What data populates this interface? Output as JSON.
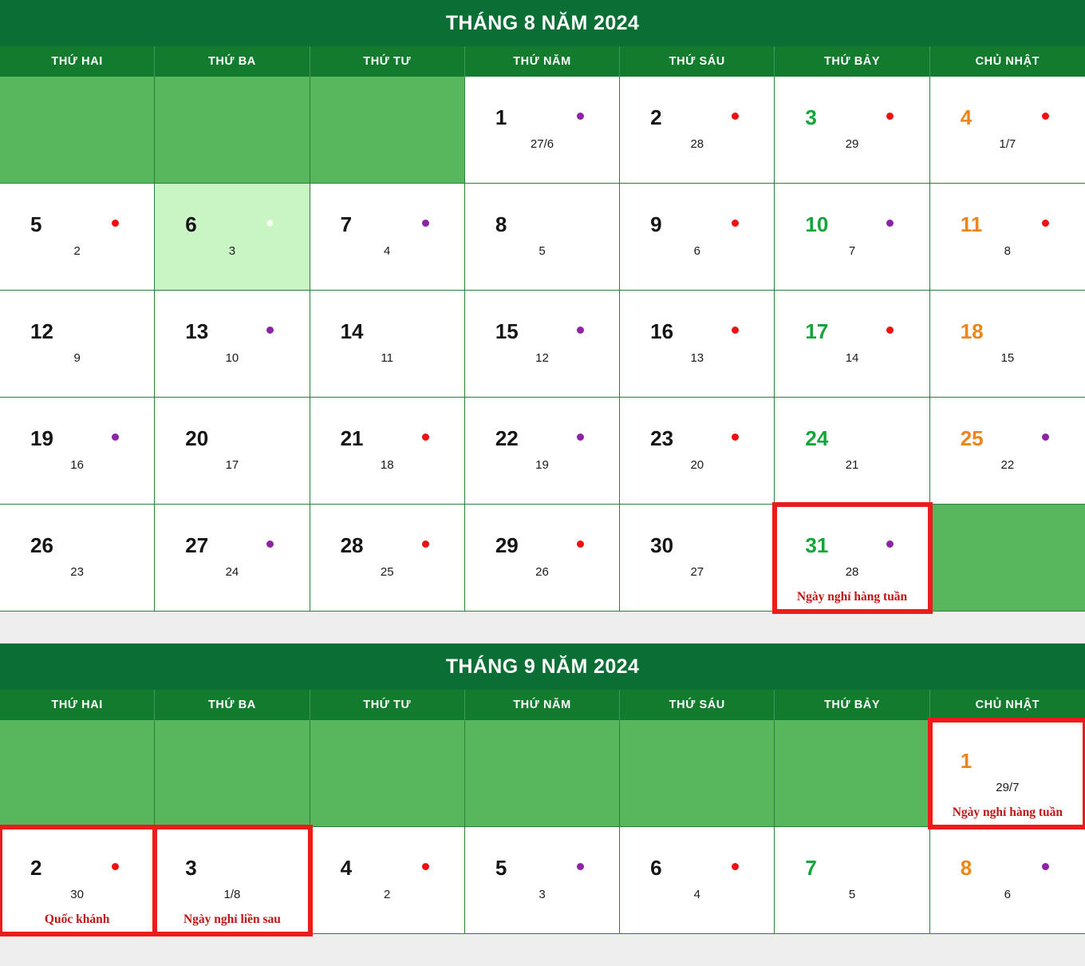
{
  "colors": {
    "header_dark_green": "#0b6e34",
    "header_green": "#137b2d",
    "blank_green": "#58b75c",
    "today_green": "#c9f5c4",
    "saturday": "#13a538",
    "sunday": "#ef8419",
    "note_red": "#c01515",
    "marker_red": "#ee1b1b",
    "dot_red": "#ee1111",
    "dot_purple": "#8d24a6"
  },
  "weekdays": [
    "THỨ HAI",
    "THỨ BA",
    "THỨ TƯ",
    "THỨ NĂM",
    "THỨ SÁU",
    "THỨ BẢY",
    "CHỦ NHẬT"
  ],
  "months": [
    {
      "title": "THÁNG 8 NĂM 2024",
      "weekdays": [
        "THỨ HAI",
        "THỨ BA",
        "THỨ TƯ",
        "THỨ NĂM",
        "THỨ SÁU",
        "THỨ BẢY",
        "CHỦ NHẬT"
      ],
      "cells": [
        {
          "blank": true
        },
        {
          "blank": true
        },
        {
          "blank": true
        },
        {
          "day": "1",
          "lunar": "27/6",
          "dot": "purple"
        },
        {
          "day": "2",
          "lunar": "28",
          "dot": "red"
        },
        {
          "day": "3",
          "lunar": "29",
          "dot": "red",
          "kind": "sat"
        },
        {
          "day": "4",
          "lunar": "1/7",
          "dot": "red",
          "kind": "sun"
        },
        {
          "day": "5",
          "lunar": "2",
          "dot": "red"
        },
        {
          "day": "6",
          "lunar": "3",
          "dot": "pale",
          "today": true
        },
        {
          "day": "7",
          "lunar": "4",
          "dot": "purple"
        },
        {
          "day": "8",
          "lunar": "5"
        },
        {
          "day": "9",
          "lunar": "6",
          "dot": "red"
        },
        {
          "day": "10",
          "lunar": "7",
          "dot": "purple",
          "kind": "sat"
        },
        {
          "day": "11",
          "lunar": "8",
          "dot": "red",
          "kind": "sun"
        },
        {
          "day": "12",
          "lunar": "9"
        },
        {
          "day": "13",
          "lunar": "10",
          "dot": "purple"
        },
        {
          "day": "14",
          "lunar": "11"
        },
        {
          "day": "15",
          "lunar": "12",
          "dot": "purple"
        },
        {
          "day": "16",
          "lunar": "13",
          "dot": "red"
        },
        {
          "day": "17",
          "lunar": "14",
          "dot": "red",
          "kind": "sat"
        },
        {
          "day": "18",
          "lunar": "15",
          "kind": "sun"
        },
        {
          "day": "19",
          "lunar": "16",
          "dot": "purple"
        },
        {
          "day": "20",
          "lunar": "17"
        },
        {
          "day": "21",
          "lunar": "18",
          "dot": "red"
        },
        {
          "day": "22",
          "lunar": "19",
          "dot": "purple"
        },
        {
          "day": "23",
          "lunar": "20",
          "dot": "red"
        },
        {
          "day": "24",
          "lunar": "21",
          "kind": "sat"
        },
        {
          "day": "25",
          "lunar": "22",
          "dot": "purple",
          "kind": "sun"
        },
        {
          "day": "26",
          "lunar": "23"
        },
        {
          "day": "27",
          "lunar": "24",
          "dot": "purple"
        },
        {
          "day": "28",
          "lunar": "25",
          "dot": "red"
        },
        {
          "day": "29",
          "lunar": "26",
          "dot": "red"
        },
        {
          "day": "30",
          "lunar": "27"
        },
        {
          "day": "31",
          "lunar": "28",
          "dot": "purple",
          "kind": "sat",
          "note": "Ngày nghỉ hàng tuần",
          "marked": true
        },
        {
          "blank": true
        }
      ]
    },
    {
      "title": "THÁNG 9 NĂM 2024",
      "weekdays": [
        "THỨ HAI",
        "THỨ BA",
        "THỨ TƯ",
        "THỨ NĂM",
        "THỨ SÁU",
        "THỨ BẢY",
        "CHỦ NHẬT"
      ],
      "cells": [
        {
          "blank": true
        },
        {
          "blank": true
        },
        {
          "blank": true
        },
        {
          "blank": true
        },
        {
          "blank": true
        },
        {
          "blank": true
        },
        {
          "day": "1",
          "lunar": "29/7",
          "kind": "sun",
          "note": "Ngày nghỉ hàng tuần",
          "marked": true
        },
        {
          "day": "2",
          "lunar": "30",
          "dot": "red",
          "note": "Quốc khánh",
          "marked": true
        },
        {
          "day": "3",
          "lunar": "1/8",
          "note": "Ngày nghỉ liền sau",
          "marked": true
        },
        {
          "day": "4",
          "lunar": "2",
          "dot": "red"
        },
        {
          "day": "5",
          "lunar": "3",
          "dot": "purple"
        },
        {
          "day": "6",
          "lunar": "4",
          "dot": "red"
        },
        {
          "day": "7",
          "lunar": "5",
          "kind": "sat"
        },
        {
          "day": "8",
          "lunar": "6",
          "dot": "purple",
          "kind": "sun"
        }
      ]
    }
  ]
}
